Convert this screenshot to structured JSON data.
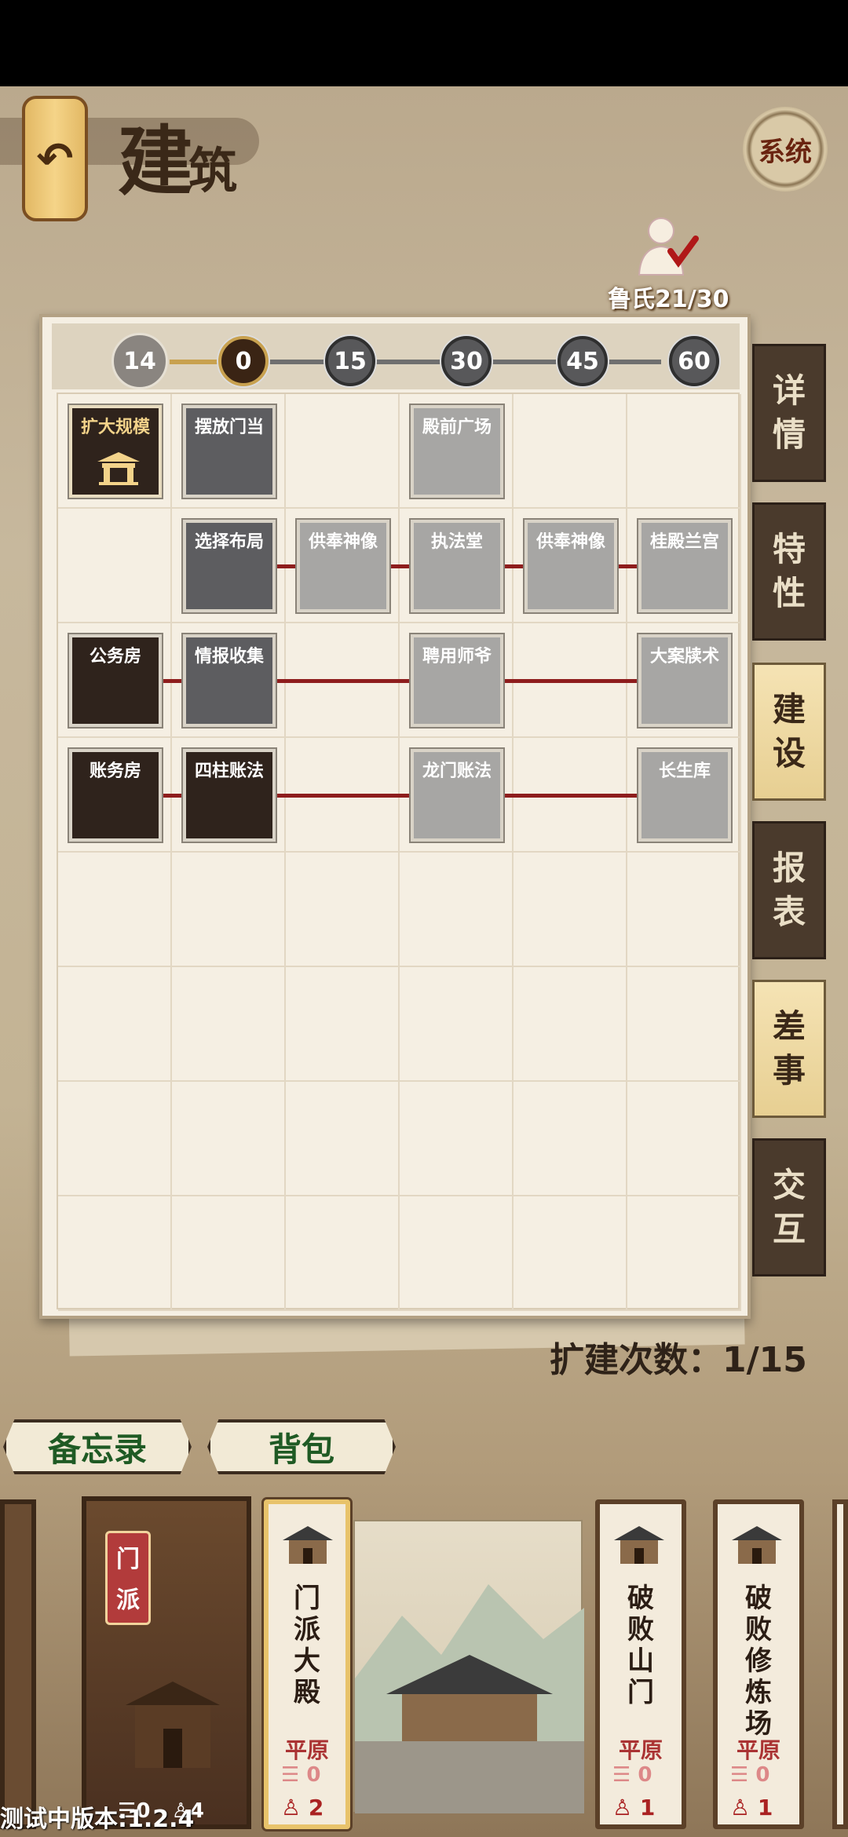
{
  "header": {
    "title_main": "建",
    "title_small": "筑",
    "system_label": "系统",
    "worker_count": "鲁氏21/30"
  },
  "board": {
    "current_level": "14",
    "milestones": [
      "0",
      "15",
      "30",
      "45",
      "60"
    ],
    "active_milestone": "0",
    "rows": [
      [
        {
          "label": "扩大规模",
          "state": "special"
        },
        {
          "label": "摆放门当",
          "state": "mid"
        },
        null,
        {
          "label": "殿前广场",
          "state": "light"
        },
        null,
        null
      ],
      [
        null,
        {
          "label": "选择布局",
          "state": "mid"
        },
        {
          "label": "供奉神像",
          "state": "light"
        },
        {
          "label": "执法堂",
          "state": "light"
        },
        {
          "label": "供奉神像",
          "state": "light"
        },
        {
          "label": "桂殿兰宫",
          "state": "light"
        }
      ],
      [
        {
          "label": "公务房",
          "state": "dark"
        },
        {
          "label": "情报收集",
          "state": "mid"
        },
        null,
        {
          "label": "聘用师爷",
          "state": "light"
        },
        null,
        {
          "label": "大案牍术",
          "state": "light"
        }
      ],
      [
        {
          "label": "账务房",
          "state": "dark"
        },
        {
          "label": "四柱账法",
          "state": "dark"
        },
        null,
        {
          "label": "龙门账法",
          "state": "light"
        },
        null,
        {
          "label": "长生库",
          "state": "light"
        }
      ]
    ]
  },
  "side_tabs": [
    {
      "line1": "详",
      "line2": "情",
      "style": "dark"
    },
    {
      "line1": "特",
      "line2": "性",
      "style": "dark"
    },
    {
      "line1": "建",
      "line2": "设",
      "style": "gold"
    },
    {
      "line1": "报",
      "line2": "表",
      "style": "dark"
    },
    {
      "line1": "差",
      "line2": "事",
      "style": "gold"
    },
    {
      "line1": "交",
      "line2": "互",
      "style": "dark"
    }
  ],
  "expand_count": "扩建次数：1/15",
  "buttons": {
    "memo": "备忘录",
    "bag": "背包"
  },
  "cards": {
    "sect": {
      "tag_line1": "门",
      "tag_line2": "派",
      "scrolls": "0",
      "people": "4"
    },
    "items": [
      {
        "name_lines": [
          "门",
          "派",
          "大",
          "殿"
        ],
        "terrain": "平原",
        "scrolls": "0",
        "people": "2",
        "selected": true
      },
      {
        "name_lines": [
          "破",
          "败",
          "山",
          "门"
        ],
        "terrain": "平原",
        "scrolls": "0",
        "people": "1",
        "selected": false
      },
      {
        "name_lines": [
          "破",
          "败",
          "修",
          "炼",
          "场"
        ],
        "terrain": "平原",
        "scrolls": "0",
        "people": "1",
        "selected": false
      }
    ]
  },
  "version": "测试中版本:1.2.4"
}
